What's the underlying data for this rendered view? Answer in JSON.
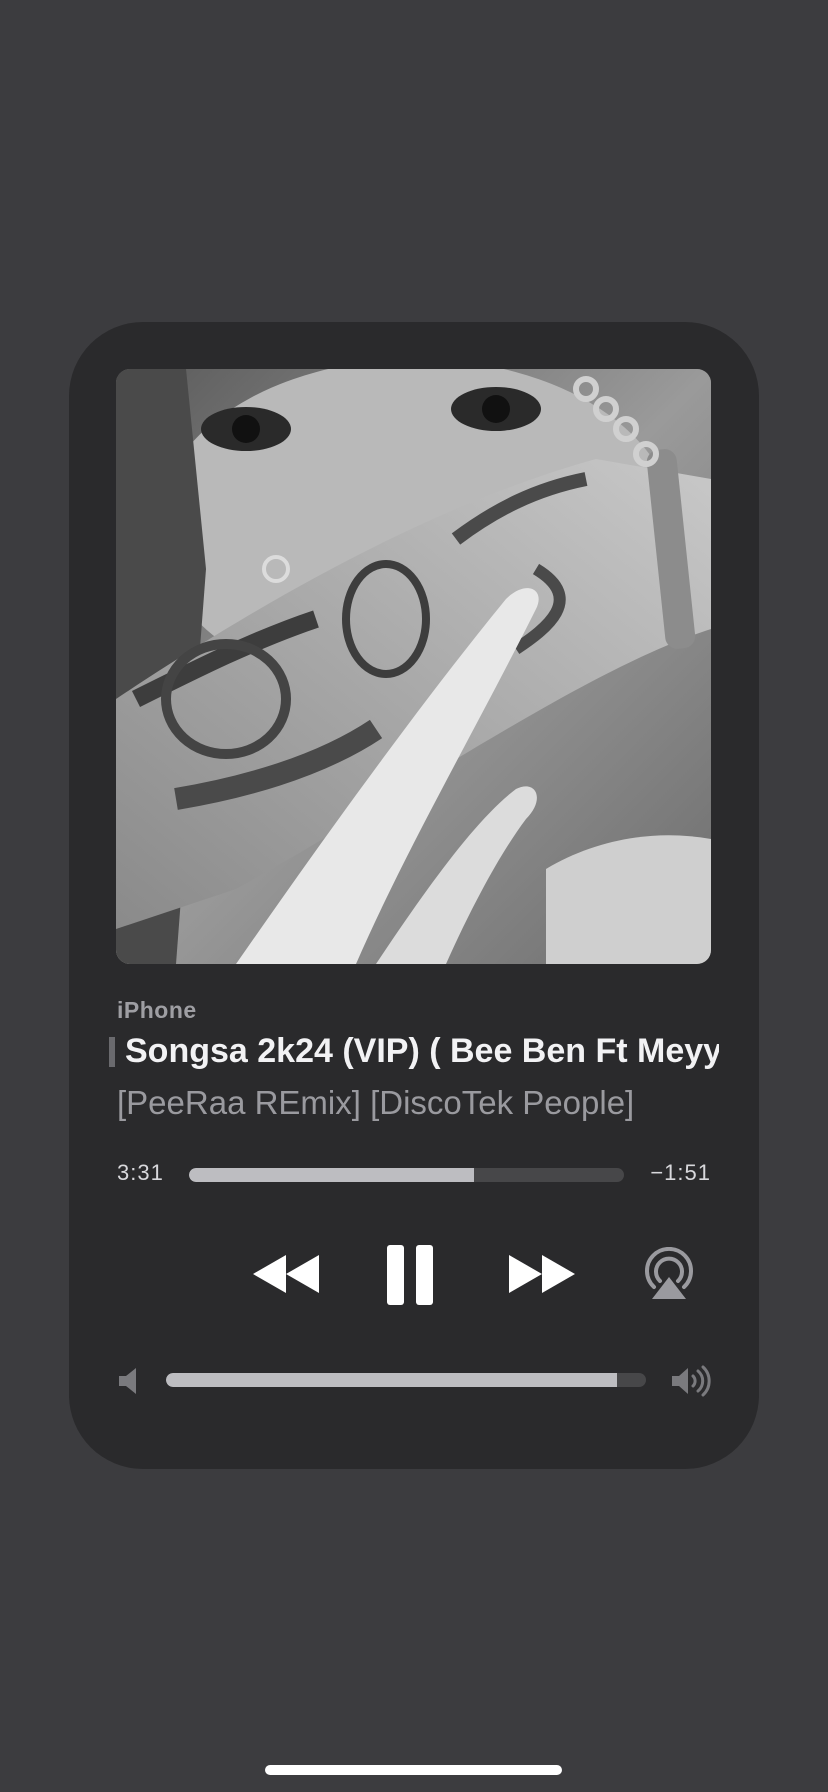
{
  "now_playing": {
    "source": "iPhone",
    "title": "Songsa 2k24 (VIP) ( Bee Ben Ft Meyy",
    "subtitle": "[PeeRaa REmix] [DiscoTek People]",
    "elapsed": "3:31",
    "remaining": "−1:51",
    "progress": 0.655,
    "volume": 0.94
  },
  "controls": {
    "rewind_icon": "backward-icon",
    "pause_icon": "pause-icon",
    "forward_icon": "forward-icon",
    "airplay_icon": "airplay-icon",
    "volume_low_icon": "speaker-low-icon",
    "volume_high_icon": "speaker-high-icon"
  },
  "colors": {
    "background": "#3c3c3f",
    "card": "#2a2a2c",
    "accent_fill": "#bdbdc1",
    "track": "#474749"
  }
}
